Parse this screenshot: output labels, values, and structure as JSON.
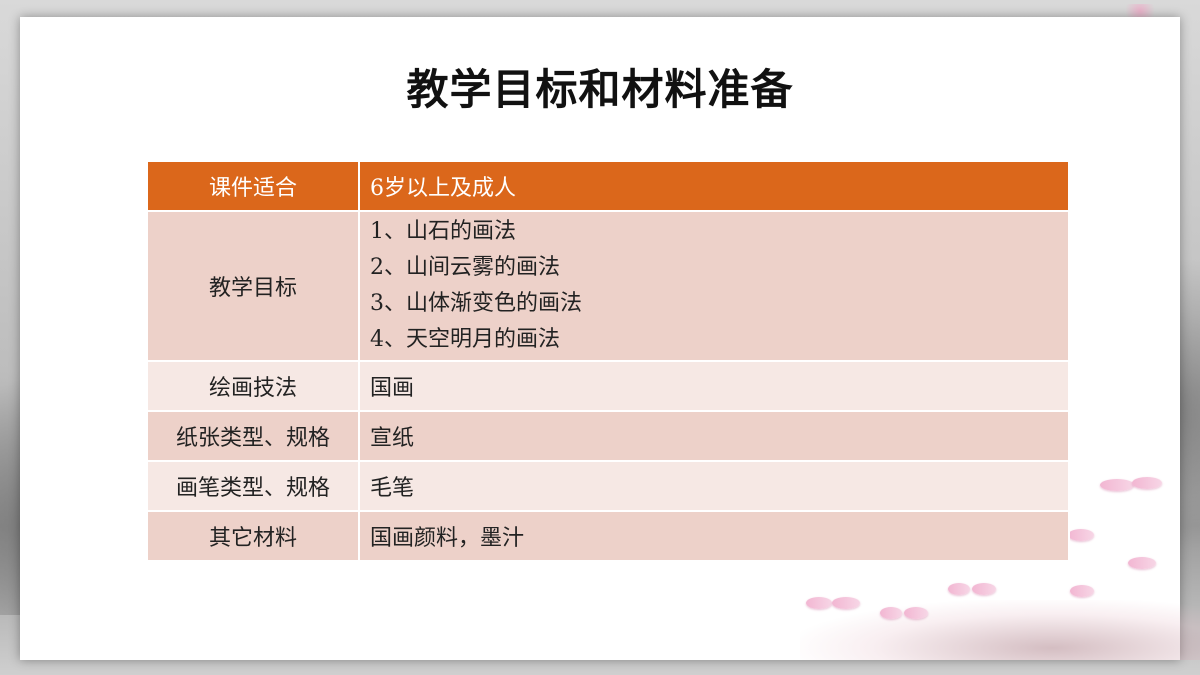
{
  "slide": {
    "title": "教学目标和材料准备"
  },
  "table": {
    "header": {
      "label": "课件适合",
      "value": "6岁以上及成人"
    },
    "goals": {
      "label": "教学目标",
      "items": [
        "1、山石的画法",
        "2、山间云雾的画法",
        "3、山体渐变色的画法",
        "4、天空明月的画法"
      ]
    },
    "rows": [
      {
        "label": "绘画技法",
        "value": "国画"
      },
      {
        "label": "纸张类型、规格",
        "value": "宣纸"
      },
      {
        "label": "画笔类型、规格",
        "value": "毛笔"
      },
      {
        "label": "其它材料",
        "value": "国画颜料，墨汁"
      }
    ]
  },
  "colors": {
    "header_bg": "#db671b",
    "row_dark": "#edd1c9",
    "row_light": "#f6e8e4",
    "backdrop": "#bdbdbd"
  }
}
